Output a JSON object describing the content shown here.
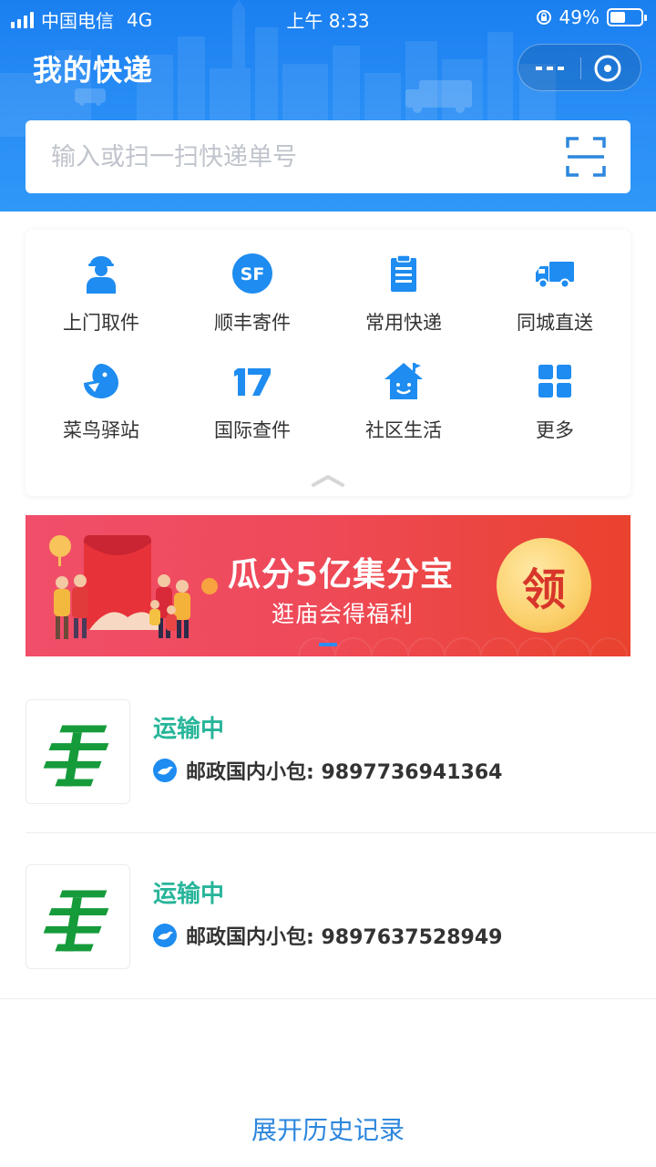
{
  "status_bar": {
    "carrier": "中国电信",
    "network": "4G",
    "time": "上午 8:33",
    "battery": "49%",
    "battery_level": 0.49
  },
  "header": {
    "title": "我的快递",
    "more_icon": "more-dots-icon",
    "close_icon": "close-circle-icon"
  },
  "search": {
    "placeholder": "输入或扫一扫快递单号",
    "value": "",
    "scan_icon": "scan-icon"
  },
  "services": [
    {
      "label": "上门取件",
      "icon": "courier-person-icon"
    },
    {
      "label": "顺丰寄件",
      "icon": "sf-logo-icon"
    },
    {
      "label": "常用快递",
      "icon": "clipboard-icon"
    },
    {
      "label": "同城直送",
      "icon": "truck-icon"
    },
    {
      "label": "菜鸟驿站",
      "icon": "cainiao-bird-icon"
    },
    {
      "label": "国际查件",
      "icon": "17-logo-icon"
    },
    {
      "label": "社区生活",
      "icon": "house-icon"
    },
    {
      "label": "更多",
      "icon": "grid-icon"
    }
  ],
  "banner": {
    "title": "瓜分5亿集分宝",
    "subtitle": "逛庙会得福利",
    "button": "领"
  },
  "packages": [
    {
      "status": "运输中",
      "carrier_line": "邮政国内小包: 9897736941364",
      "logo": "china-post-logo"
    },
    {
      "status": "运输中",
      "carrier_line": "邮政国内小包: 9897637528949",
      "logo": "china-post-logo"
    }
  ],
  "footer": {
    "history_link": "展开历史记录"
  },
  "colors": {
    "header_blue": "#1a7ff0",
    "icon_blue": "#1e8cf0",
    "status_green": "#27b59a",
    "link_blue": "#2d87de",
    "post_green": "#169b3b"
  }
}
